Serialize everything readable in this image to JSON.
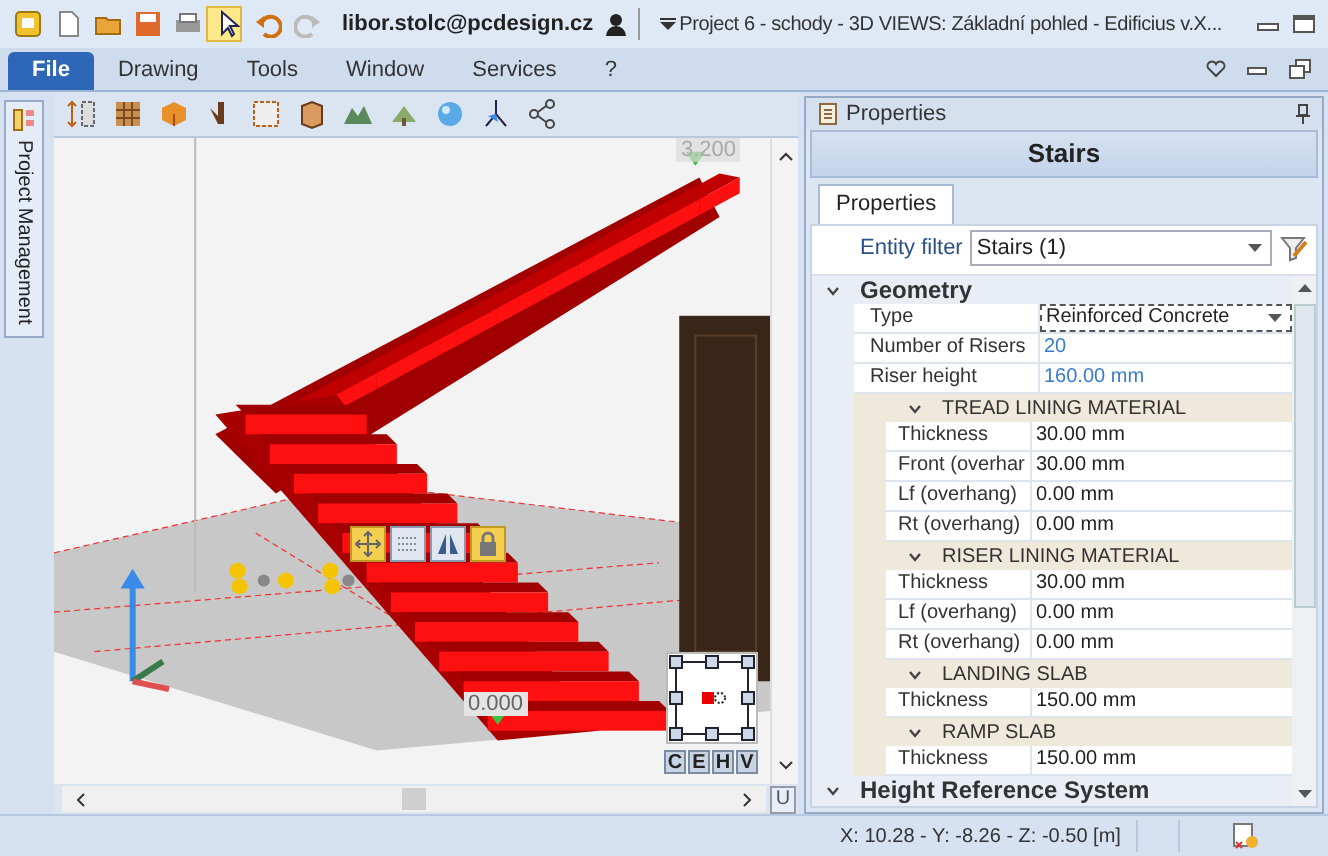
{
  "title_bar": {
    "user": "libor.stolc@pcdesign.cz",
    "title": "Project 6 - schody -  3D VIEWS: Základní pohled - Edificius v.X...",
    "tools": [
      {
        "kind": "app",
        "selected": false
      },
      {
        "kind": "new",
        "selected": false
      },
      {
        "kind": "open",
        "selected": false
      },
      {
        "kind": "save",
        "selected": false
      },
      {
        "kind": "print",
        "selected": false
      },
      {
        "kind": "pointer",
        "selected": true
      },
      {
        "kind": "undo",
        "selected": false
      },
      {
        "kind": "redo",
        "selected": false
      }
    ]
  },
  "menu": [
    {
      "label": "File",
      "selected": true
    },
    {
      "label": "Drawing",
      "selected": false
    },
    {
      "label": "Tools",
      "selected": false
    },
    {
      "label": "Window",
      "selected": false
    },
    {
      "label": "Services",
      "selected": false
    },
    {
      "label": "?",
      "selected": false
    }
  ],
  "side_tab": "Project Management",
  "viewport": {
    "top_elevation": "3.200",
    "bottom_elevation": "0.000",
    "view_buttons": [
      "C",
      "E",
      "H",
      "V"
    ],
    "corner_button": "U",
    "grip_tools": [
      {
        "kind": "move",
        "selected": true
      },
      {
        "kind": "grid",
        "selected": false
      },
      {
        "kind": "mirror",
        "selected": false
      },
      {
        "kind": "lock",
        "selected": true
      }
    ]
  },
  "properties": {
    "panel_title": "Properties",
    "object_title": "Stairs",
    "tabs": [
      {
        "label": "Properties",
        "selected": true
      }
    ],
    "entity_filter": {
      "label": "Entity filter",
      "value": "Stairs (1)"
    },
    "sections": [
      {
        "title": "Geometry",
        "expanded": true,
        "rows": [
          {
            "name": "Type",
            "value": "Reinforced Concrete",
            "kind": "dropdown"
          },
          {
            "name": "Number of Risers",
            "value": "20",
            "kind": "linked"
          },
          {
            "name": "Riser height",
            "value": "160.00 mm",
            "kind": "linked"
          }
        ],
        "groups": [
          {
            "title": "TREAD LINING MATERIAL",
            "expanded": true,
            "rows": [
              {
                "name": "Thickness",
                "value": "30.00 mm"
              },
              {
                "name": "Front (overhar",
                "value": "30.00 mm"
              },
              {
                "name": "Lf (overhang)",
                "value": "0.00 mm"
              },
              {
                "name": "Rt (overhang)",
                "value": "0.00 mm"
              }
            ]
          },
          {
            "title": "RISER LINING MATERIAL",
            "expanded": true,
            "rows": [
              {
                "name": "Thickness",
                "value": "30.00 mm"
              },
              {
                "name": "Lf (overhang)",
                "value": "0.00 mm"
              },
              {
                "name": "Rt (overhang)",
                "value": "0.00 mm"
              }
            ]
          },
          {
            "title": "LANDING SLAB",
            "expanded": true,
            "rows": [
              {
                "name": "Thickness",
                "value": "150.00 mm"
              }
            ]
          },
          {
            "title": "RAMP SLAB",
            "expanded": true,
            "rows": [
              {
                "name": "Thickness",
                "value": "150.00 mm"
              }
            ]
          }
        ]
      },
      {
        "title": "Height Reference System",
        "expanded": true
      }
    ]
  },
  "status_bar": {
    "coordinates": "X: 10.28 - Y: -8.26 - Z: -0.50 [m]"
  }
}
